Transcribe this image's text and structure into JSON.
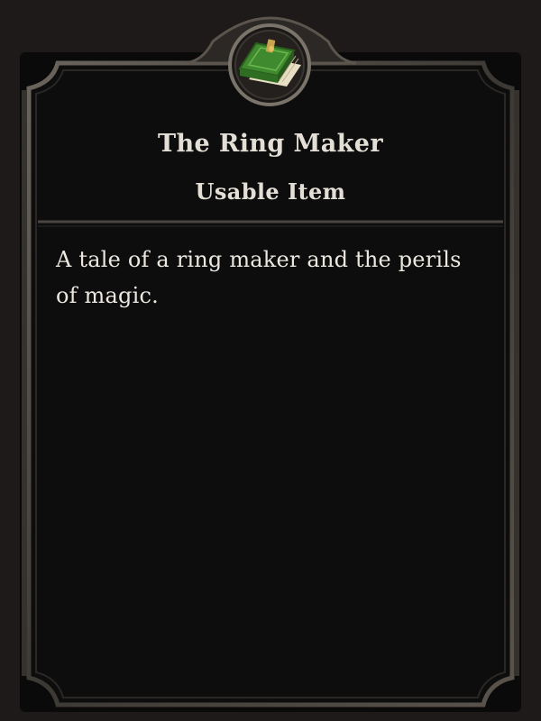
{
  "tooltip": {
    "title": "The Ring Maker",
    "item_type": "Usable Item",
    "description": "A tale of a ring maker and the perils of magic.",
    "icon": "green-book-icon"
  },
  "colors": {
    "frame_background": "#0d0d0d",
    "page_background": "#1e1a1a",
    "border": "#4a4540",
    "text": "#e3dfd6",
    "book_green": "#3f8a2e",
    "book_clasp": "#c9a44a"
  }
}
